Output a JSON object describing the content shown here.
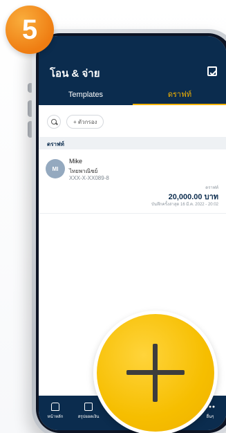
{
  "step_badge": "5",
  "header": {
    "title": "โอน & จ่าย",
    "tabs": [
      {
        "label": "Templates",
        "active": false
      },
      {
        "label": "ดราฟท์",
        "active": true
      }
    ],
    "bg_color": "#0b2c4e",
    "accent_color": "#f5b301"
  },
  "filter": {
    "chip_label": "+ ตัวกรอง"
  },
  "section": {
    "label": "ดราฟท์"
  },
  "draft_item": {
    "avatar_initials": "MI",
    "name": "Mike",
    "bank": "ไทยพาณิชย์",
    "account": "XXX-X-XX089-8",
    "amount_label": "ดราฟท์",
    "amount": "20,000.00 บาท",
    "saved_text": "บันทึกครั้งล่าสุด 16 มี.ค. 2022 - 20:02"
  },
  "bottom_nav": {
    "items": [
      {
        "label": "หน้าหลัก",
        "icon": "home-icon"
      },
      {
        "label": "สรุปยอดเงิน",
        "icon": "doc-icon"
      },
      {
        "label": "อื่นๆ",
        "icon": "more-icon"
      }
    ]
  },
  "fab": {
    "icon": "plus-icon",
    "color": "#f6be00"
  }
}
